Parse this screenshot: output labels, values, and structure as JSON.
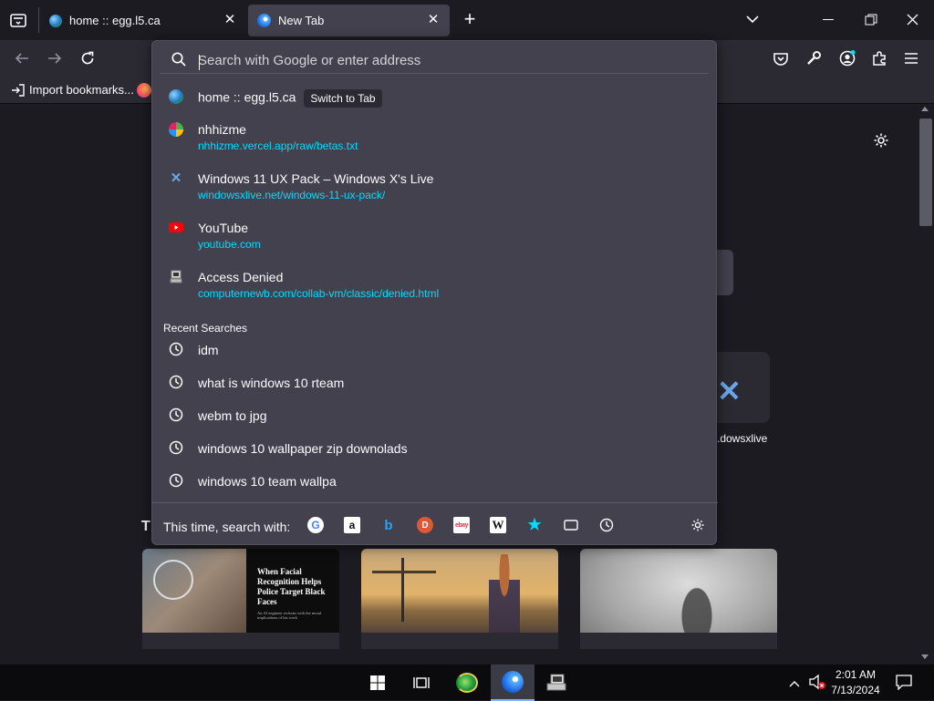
{
  "tabs": [
    {
      "title": "home :: egg.l5.ca",
      "icon": "globe-icon"
    },
    {
      "title": "New Tab",
      "icon": "firefox-icon"
    }
  ],
  "bookmarks": {
    "import_label": "Import bookmarks..."
  },
  "urlbar": {
    "placeholder": "Search with Google or enter address",
    "value": ""
  },
  "suggestions": [
    {
      "title": "home :: egg.l5.ca",
      "action": "Switch to Tab",
      "icon": "globe-icon"
    },
    {
      "title": "nhhizme",
      "url": "nhhizme.vercel.app/raw/betas.txt",
      "icon": "colorful-favicon-icon"
    },
    {
      "title": "Windows 11 UX Pack – Windows X's Live",
      "url": "windowsxlive.net/windows-11-ux-pack/",
      "icon": "windowsx-icon"
    },
    {
      "title": "YouTube",
      "url": "youtube.com",
      "icon": "youtube-icon"
    },
    {
      "title": "Access Denied",
      "url": "computernewb.com/collab-vm/classic/denied.html",
      "icon": "computernewb-icon"
    }
  ],
  "recent": {
    "heading": "Recent Searches",
    "items": [
      "idm",
      "what is windows 10 rteam",
      "webm to jpg",
      "windows 10 wallpaper zip downolads",
      "windows 10 team wallpa"
    ]
  },
  "oneoff": {
    "label": "This time, search with:",
    "engines": [
      "google-icon",
      "amazon-icon",
      "bing-icon",
      "duckduckgo-icon",
      "ebay-icon",
      "wikipedia-icon",
      "bookmarks-star-icon",
      "tabs-icon",
      "history-icon",
      "search-settings-icon"
    ]
  },
  "newtab": {
    "shortcut_label": ".dowsxlive",
    "section_initial": "T",
    "tile1_headline": "When Facial Recognition Helps Police Target Black Faces",
    "tile1_sub": "An AI engineer reckons with the moral implications of his work"
  },
  "taskbar": {
    "time": "2:01 AM",
    "date": "7/13/2024"
  },
  "colors": {
    "accent": "#00ddff",
    "popup_bg": "#42414d",
    "chrome_bg": "#2b2a33",
    "page_bg": "#1c1b22"
  }
}
